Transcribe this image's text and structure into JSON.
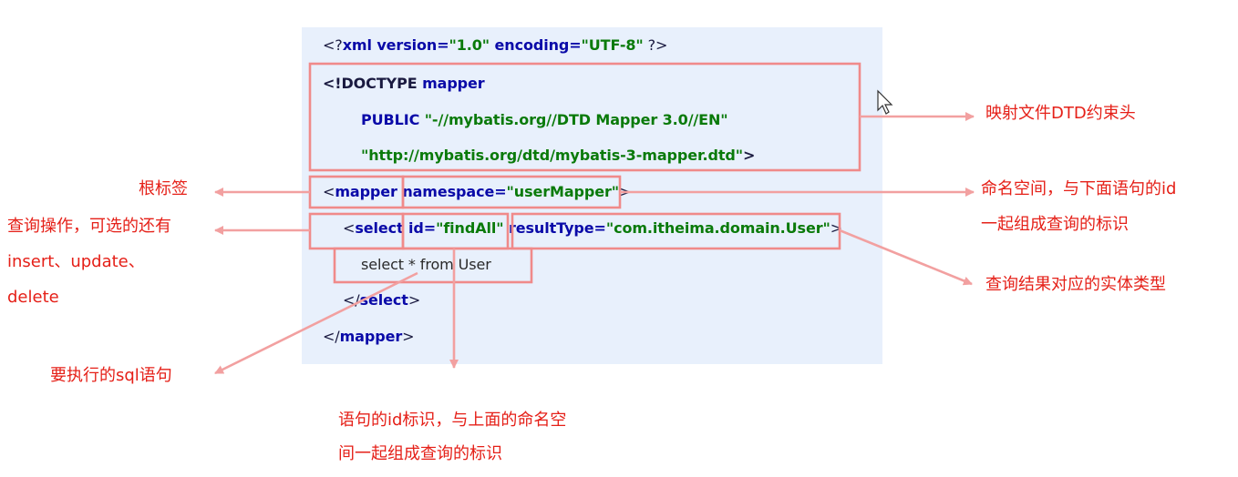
{
  "code": {
    "line1": {
      "a": "<?",
      "b": "xml version=",
      "c": "\"1.0\"",
      "d": " encoding=",
      "e": "\"UTF-8\"",
      "f": " ?>"
    },
    "line2": {
      "a": "<!DOCTYPE ",
      "b": "mapper"
    },
    "line3": {
      "a": "PUBLIC ",
      "b": "\"-//mybatis.org//DTD Mapper 3.0//EN\""
    },
    "line4": {
      "a": "\"http://mybatis.org/dtd/mybatis-3-mapper.dtd\"",
      "b": ">"
    },
    "line5": {
      "a": "<",
      "b": "mapper ",
      "c": "namespace=",
      "d": "\"userMapper\"",
      "e": ">"
    },
    "line6": {
      "a": "<",
      "b": "select ",
      "c": "id=",
      "d": "\"findAll\"",
      "e": " resultType=",
      "f": "\"com.itheima.domain.User\"",
      "g": ">"
    },
    "line7": {
      "a": "select * from User"
    },
    "line8": {
      "a": "</",
      "b": "select",
      "c": ">"
    },
    "line9": {
      "a": "</",
      "b": "mapper",
      "c": ">"
    }
  },
  "annotations": {
    "dtd": "映射文件DTD约束头",
    "root": "根标签",
    "namespace_1": "命名空间，与下面语句的id",
    "namespace_2": "一起组成查询的标识",
    "select_1": "查询操作，可选的还有",
    "select_2": "insert、update、",
    "select_3": "delete",
    "result_type": "查询结果对应的实体类型",
    "sql": "要执行的sql语句",
    "id_1": "语句的id标识，与上面的命名空",
    "id_2": "间一起组成查询的标识"
  },
  "colors": {
    "panel_bg": "#e8f0fc",
    "box_stroke": "#f08a8a",
    "arrow": "#f2a0a0",
    "annotation_text": "#e52018",
    "tag_blue": "#0a0aa8",
    "string_green": "#0a7a0a"
  },
  "icons": {
    "cursor": "mouse-pointer-icon"
  }
}
